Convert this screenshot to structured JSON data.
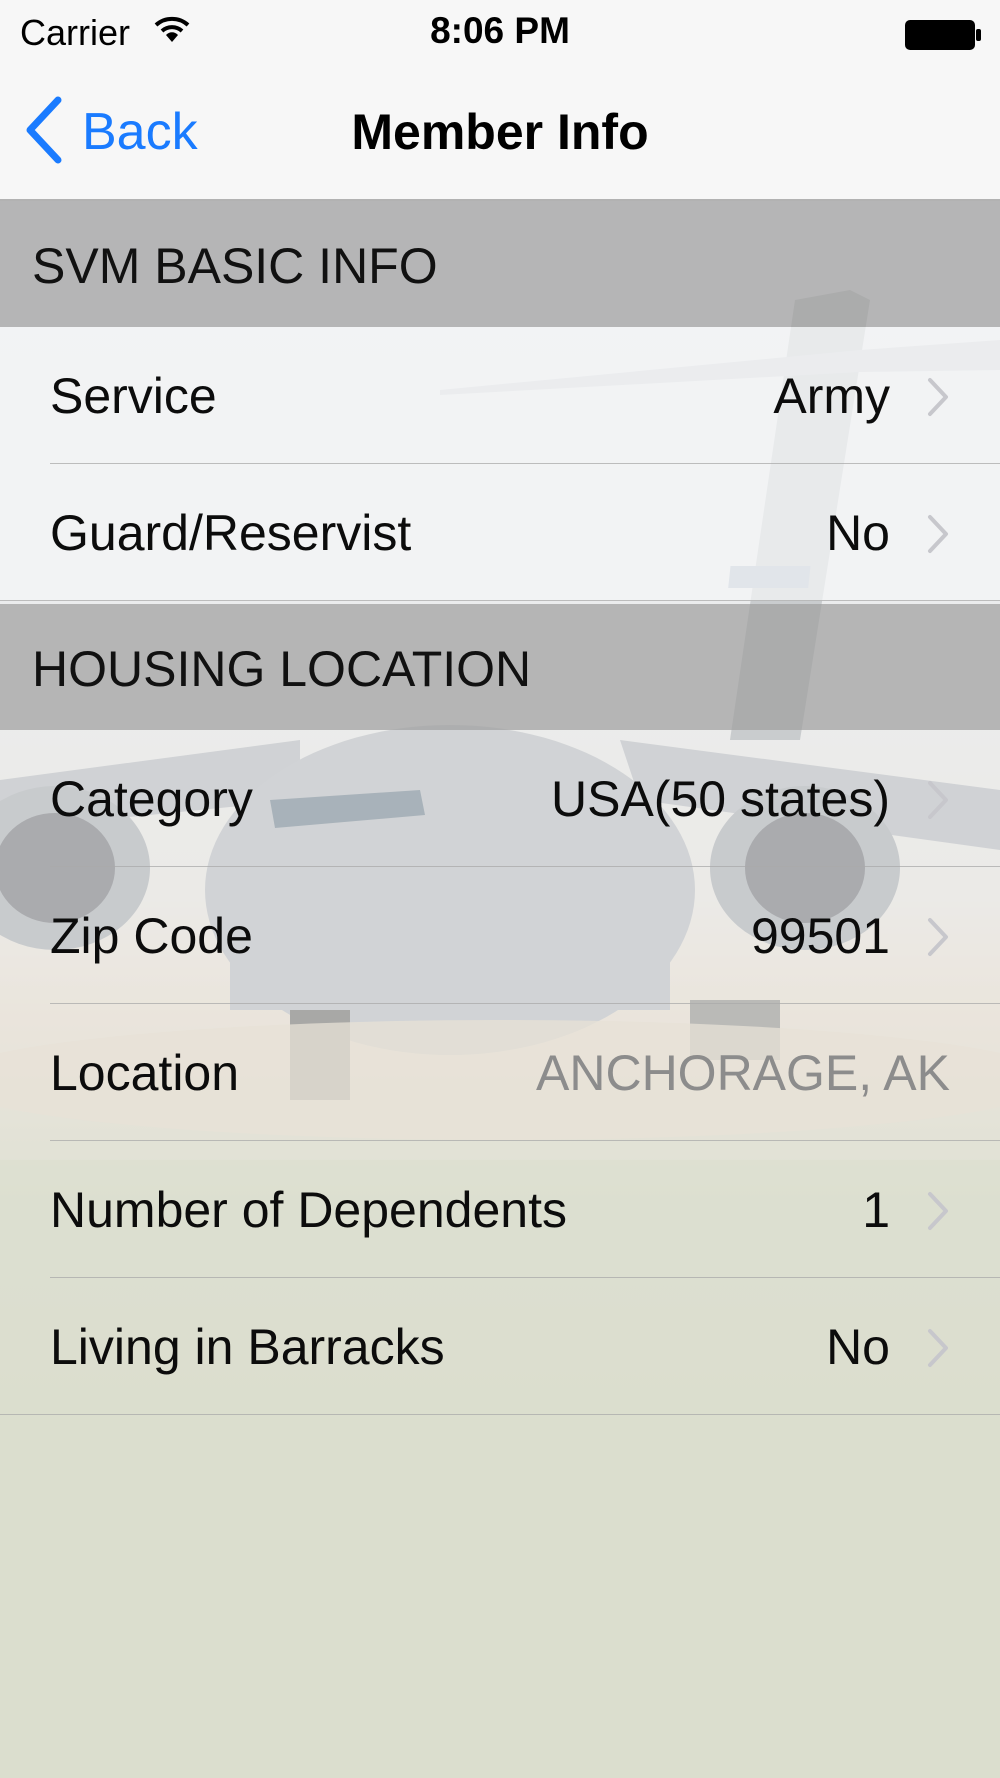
{
  "status_bar": {
    "carrier": "Carrier",
    "time": "8:06 PM",
    "wifi_icon": "wifi-icon",
    "battery_icon": "battery-icon"
  },
  "nav": {
    "back_label": "Back",
    "back_icon": "chevron-left-icon",
    "title": "Member Info",
    "accent_color": "#1a7bff"
  },
  "sections": [
    {
      "header": "SVM BASIC INFO",
      "rows": [
        {
          "label": "Service",
          "value": "Army",
          "chevron": true
        },
        {
          "label": "Guard/Reservist",
          "value": "No",
          "chevron": true
        }
      ]
    },
    {
      "header": "HOUSING LOCATION",
      "rows": [
        {
          "label": "Category",
          "value": "USA(50 states)",
          "chevron": true
        },
        {
          "label": "Zip Code",
          "value": "99501",
          "chevron": true
        },
        {
          "label": "Location",
          "value": "ANCHORAGE, AK",
          "chevron": false
        },
        {
          "label": "Number of Dependents",
          "value": "1",
          "chevron": true
        },
        {
          "label": "Living in Barracks",
          "value": "No",
          "chevron": true
        }
      ]
    }
  ],
  "background": {
    "image": "c17-aircraft-photo"
  }
}
